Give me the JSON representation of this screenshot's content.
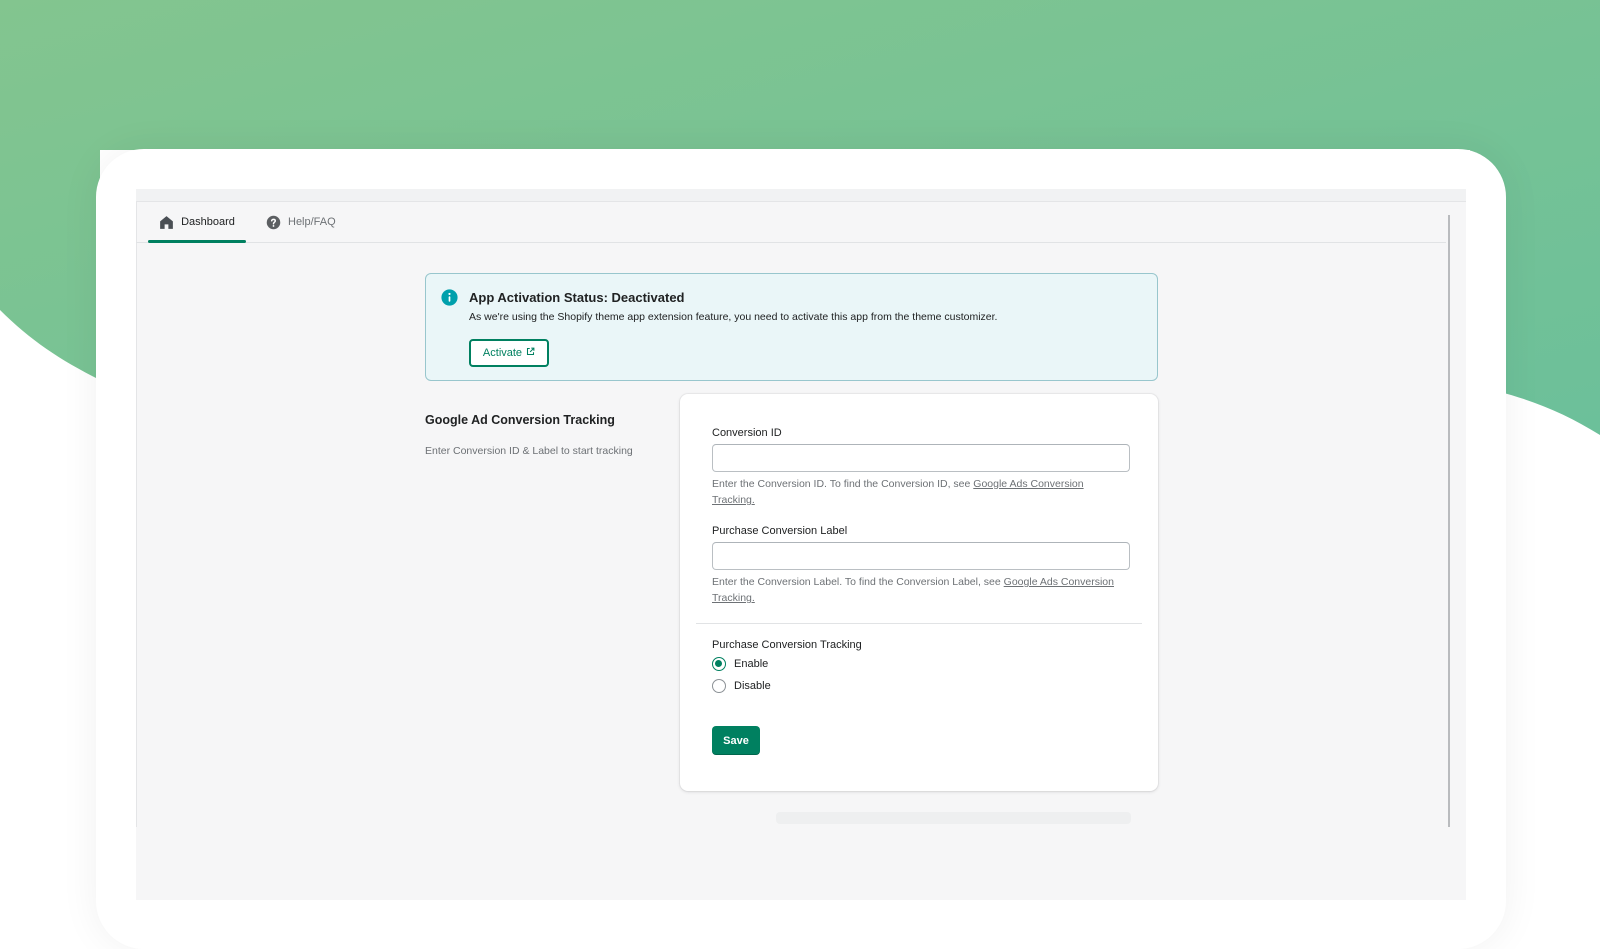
{
  "tabs": [
    {
      "label": "Dashboard",
      "icon": "home-icon",
      "active": true
    },
    {
      "label": "Help/FAQ",
      "icon": "question-circle-icon",
      "active": false
    }
  ],
  "banner": {
    "title": "App Activation Status: Deactivated",
    "text": "As we're using the Shopify theme app extension feature, you need to activate this app from the theme customizer.",
    "button_label": "Activate",
    "button_icon": "external-link-icon",
    "icon": "info-icon"
  },
  "section": {
    "title": "Google Ad Conversion Tracking",
    "description": "Enter Conversion ID & Label to start tracking"
  },
  "form": {
    "conversion_id": {
      "label": "Conversion ID",
      "value": "",
      "help_prefix": "Enter the Conversion ID. To find the Conversion ID, see",
      "help_link": "Google Ads Conversion Tracking."
    },
    "purchase_label": {
      "label": "Purchase Conversion Label",
      "value": "",
      "help_prefix": "Enter the Conversion Label. To find the Conversion Label, see",
      "help_link": "Google Ads Conversion Tracking."
    },
    "tracking": {
      "label": "Purchase Conversion Tracking",
      "options": [
        "Enable",
        "Disable"
      ],
      "selected": "Enable"
    },
    "save_label": "Save"
  },
  "colors": {
    "accent": "#008060",
    "background_green": "#82c690",
    "banner_bg": "#eaf6f8",
    "info_icon": "#00a0ac"
  }
}
